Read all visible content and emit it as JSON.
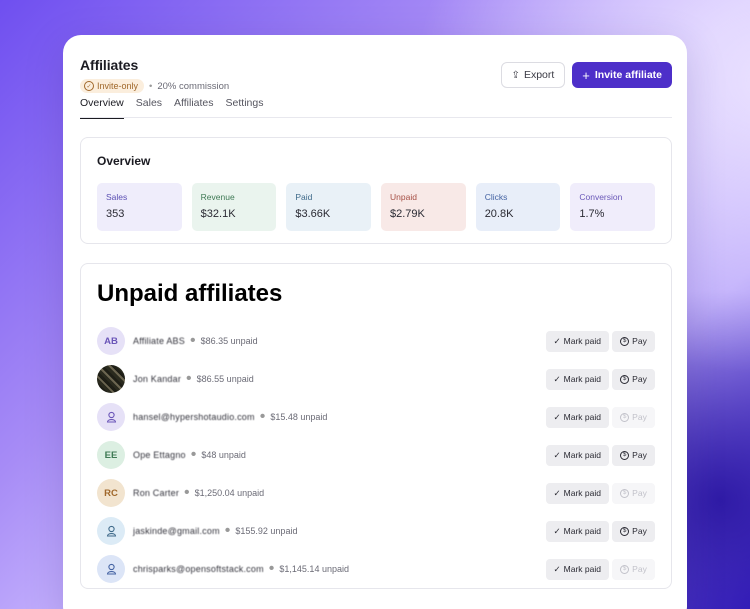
{
  "header": {
    "title": "Affiliates",
    "badge": "Invite-only",
    "commission": "20% commission",
    "export_label": "Export",
    "invite_label": "Invite affiliate"
  },
  "tabs": [
    "Overview",
    "Sales",
    "Affiliates",
    "Settings"
  ],
  "overview": {
    "heading": "Overview",
    "stats": [
      {
        "label": "Sales",
        "value": "353",
        "bg": "#efedfb",
        "color": "#5b4fb3"
      },
      {
        "label": "Revenue",
        "value": "$32.1K",
        "bg": "#eaf4ee",
        "color": "#3f7a55"
      },
      {
        "label": "Paid",
        "value": "$3.66K",
        "bg": "#e9f1f7",
        "color": "#3f6a8a"
      },
      {
        "label": "Unpaid",
        "value": "$2.79K",
        "bg": "#f8e9e7",
        "color": "#a64f45"
      },
      {
        "label": "Clicks",
        "value": "20.8K",
        "bg": "#e8eef9",
        "color": "#4463a3"
      },
      {
        "label": "Conversion",
        "value": "1.7%",
        "bg": "#f0edfb",
        "color": "#6a58b8"
      }
    ]
  },
  "unpaid": {
    "heading": "Unpaid affiliates",
    "mark_label": "Mark paid",
    "pay_label": "Pay",
    "rows": [
      {
        "initials": "AB",
        "name": "Affiliate ABS",
        "amount": "$86.35 unpaid",
        "avatar_bg": "#e6e1f7",
        "avatar_color": "#6a55b8",
        "pay_enabled": true
      },
      {
        "initials": "",
        "name": "Jon Kandar",
        "amount": "$86.55 unpaid",
        "avatar_bg": "#3a3628",
        "avatar_color": "#ffffff",
        "pay_enabled": true
      },
      {
        "initials": "",
        "name": "hansel@hypershotaudio.com",
        "amount": "$15.48 unpaid",
        "avatar_bg": "#e6e1f7",
        "avatar_color": "#6a55b8",
        "pay_enabled": false
      },
      {
        "initials": "EE",
        "name": "Ope Ettagno",
        "amount": "$48 unpaid",
        "avatar_bg": "#dcefe2",
        "avatar_color": "#3f7a55",
        "pay_enabled": true
      },
      {
        "initials": "RC",
        "name": "Ron Carter",
        "amount": "$1,250.04 unpaid",
        "avatar_bg": "#f2e4cf",
        "avatar_color": "#a0682b",
        "pay_enabled": false
      },
      {
        "initials": "",
        "name": "jaskinde@gmail.com",
        "amount": "$155.92 unpaid",
        "avatar_bg": "#dcebf6",
        "avatar_color": "#3f6a8a",
        "pay_enabled": true
      },
      {
        "initials": "",
        "name": "chrisparks@opensoftstack.com",
        "amount": "$1,145.14 unpaid",
        "avatar_bg": "#dce5f7",
        "avatar_color": "#4463a3",
        "pay_enabled": false
      }
    ]
  }
}
